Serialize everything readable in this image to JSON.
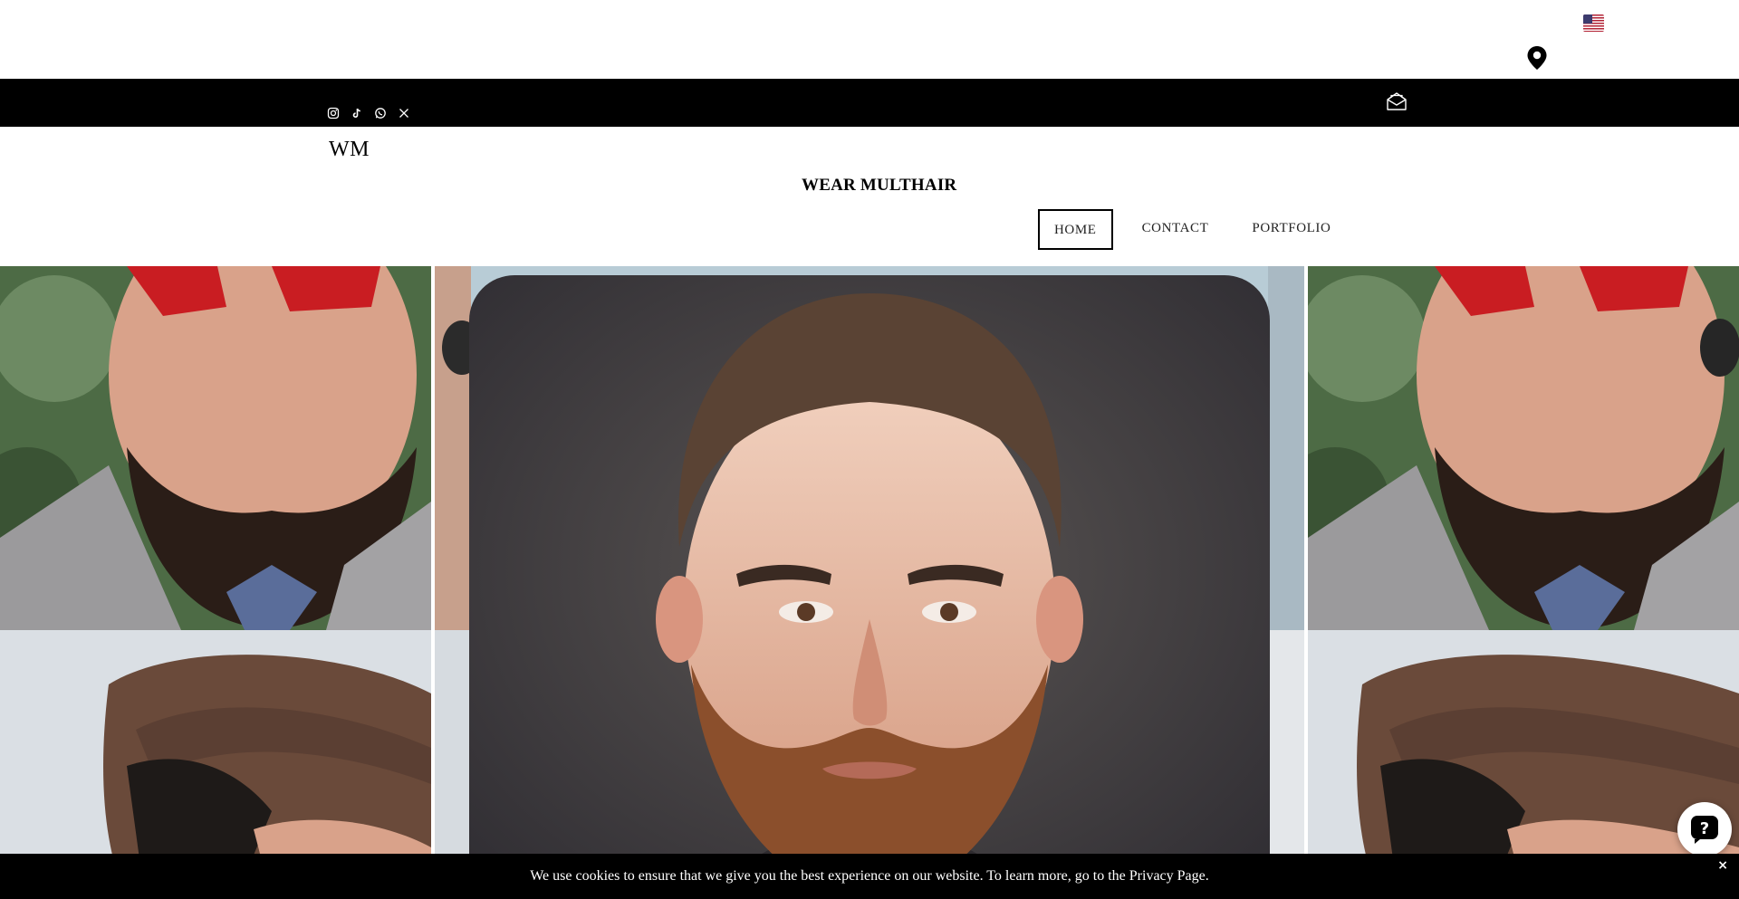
{
  "topbar": {
    "language_flag": "us-flag-icon",
    "location_icon": "map-pin-icon"
  },
  "social": {
    "icons": [
      "instagram-icon",
      "tiktok-icon",
      "whatsapp-icon",
      "x-icon"
    ],
    "mail_icon": "envelope-open-icon"
  },
  "header": {
    "logo_text": "WM",
    "site_name": "WEAR MULTHAIR"
  },
  "nav": {
    "items": [
      {
        "label": "HOME",
        "active": true
      },
      {
        "label": "CONTACT",
        "active": false
      },
      {
        "label": "PORTFOLIO",
        "active": false
      }
    ]
  },
  "hero": {
    "images": [
      "bearded-man-red-glasses-photo",
      "man-with-hat-photo",
      "bearded-man-portrait-photo"
    ]
  },
  "cookie": {
    "message": "We use cookies to ensure that we give you the best experience on our website. To learn more, go to the Privacy Page.",
    "close_label": "×"
  },
  "help_button": {
    "icon": "question-mark-icon"
  },
  "colors": {
    "bar_black": "#000000",
    "background": "#ffffff",
    "nav_text": "#222222"
  }
}
